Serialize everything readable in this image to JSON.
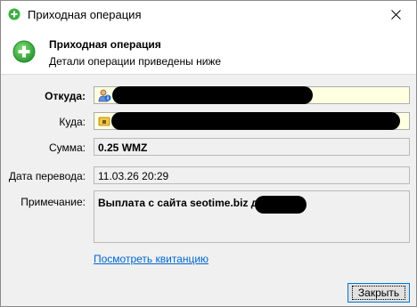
{
  "window": {
    "title": "Приходная операция",
    "close_glyph": "✕"
  },
  "header": {
    "title": "Приходная операция",
    "subtitle": "Детали операции приведены ниже"
  },
  "fields": {
    "from_label": "Откуда:",
    "to_label": "Куда:",
    "amount_label": "Сумма:",
    "amount_value": "0.25 WMZ",
    "date_label": "Дата перевода:",
    "date_value": "11.03.26 20:29",
    "note_label": "Примечание:",
    "note_value": "Выплата с сайта seotime.biz для"
  },
  "link": {
    "receipt": "Посмотреть квитанцию"
  },
  "buttons": {
    "close_label": "Закрыть"
  },
  "colors": {
    "accent_green": "#3cb043",
    "link_blue": "#0066cc",
    "focus_blue": "#0078d7",
    "field_yellow": "#ffffe1"
  },
  "icons": {
    "title": "green-plus-circle-icon",
    "header": "green-plus-circle-icon",
    "from": "user-info-icon",
    "to": "wallet-lock-icon"
  }
}
